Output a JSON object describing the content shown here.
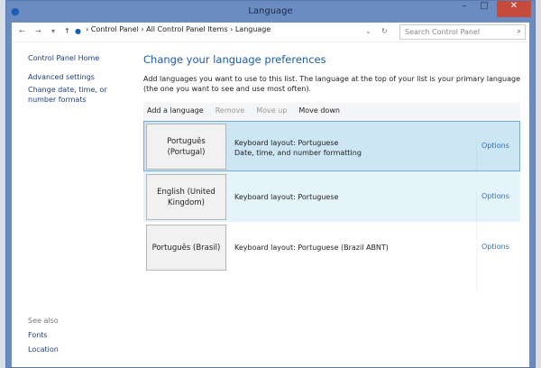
{
  "window": {
    "title": "Language",
    "minimize": "–",
    "maximize": "□",
    "close": "✕"
  },
  "nav": {
    "back": "←",
    "forward": "→",
    "recent": "▾",
    "up": "↑",
    "breadcrumb": [
      "Control Panel",
      "All Control Panel Items",
      "Language"
    ],
    "sep": "›",
    "dropdown": "⌄",
    "refresh": "↻",
    "search_placeholder": "Search Control Panel",
    "search_icon": "⌕"
  },
  "sidebar": {
    "items": [
      "Control Panel Home",
      "Advanced settings",
      "Change date, time, or number formats"
    ],
    "see_also": "See also",
    "see_also_items": [
      "Fonts",
      "Location"
    ]
  },
  "main": {
    "title": "Change your language preferences",
    "description": "Add languages you want to use to this list. The language at the top of your list is your primary language (the one you want to see and use most often).",
    "toolbar": [
      "Add a language",
      "Remove",
      "Move up",
      "Move down"
    ],
    "languages": [
      {
        "name": "Português (Portugal)",
        "lines": [
          "Keyboard layout: Portuguese",
          "Date, time, and number formatting"
        ],
        "options": "Options"
      },
      {
        "name": "English (United Kingdom)",
        "lines": [
          "Keyboard layout: Portuguese"
        ],
        "options": "Options"
      },
      {
        "name": "Português (Brasil)",
        "lines": [
          "Keyboard layout: Portuguese (Brazil ABNT)"
        ],
        "options": "Options"
      }
    ]
  }
}
